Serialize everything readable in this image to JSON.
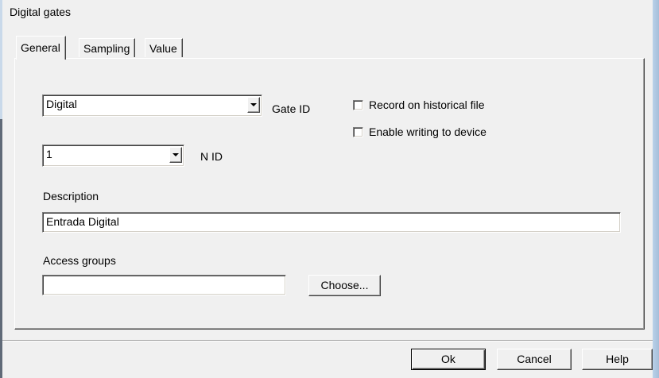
{
  "window": {
    "title": "Digital gates"
  },
  "tabs": [
    {
      "label": "General"
    },
    {
      "label": "Sampling"
    },
    {
      "label": "Value"
    }
  ],
  "general": {
    "gate_select": {
      "value": "Digital",
      "label": "Gate ID"
    },
    "n_select": {
      "value": "1",
      "label": "N ID"
    },
    "record_checkbox": {
      "label": "Record on historical file",
      "checked": false
    },
    "writing_checkbox": {
      "label": "Enable writing to device",
      "checked": false
    },
    "description": {
      "label": "Description",
      "value": "Entrada Digital"
    },
    "access_groups": {
      "label": "Access groups",
      "value": "",
      "choose_label": "Choose..."
    }
  },
  "footer": {
    "ok_label": "Ok",
    "cancel_label": "Cancel",
    "help_label": "Help"
  },
  "icons": {
    "dropdown": "chevron-down-icon"
  }
}
